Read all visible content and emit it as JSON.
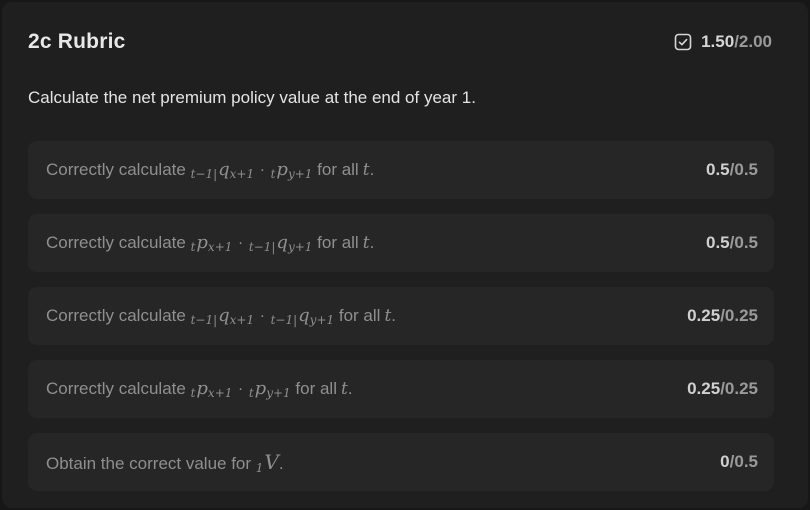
{
  "rubric": {
    "title": "2c Rubric",
    "score_earned": "1.50",
    "score_total": "/2.00",
    "question": "Calculate the net premium policy value at the end of year 1."
  },
  "items": [
    {
      "prefix": "Correctly calculate",
      "math": [
        "t−1|",
        "q",
        "x+1",
        "·",
        "t",
        "p",
        "y+1"
      ],
      "suffix_plain": "for all",
      "suffix_math": "t",
      "suffix_end": ".",
      "earned": "0.5",
      "total": "/0.5"
    },
    {
      "prefix": "Correctly calculate",
      "math": [
        "t",
        "p",
        "x+1",
        "·",
        "t−1|",
        "q",
        "y+1"
      ],
      "suffix_plain": "for all",
      "suffix_math": "t",
      "suffix_end": ".",
      "earned": "0.5",
      "total": "/0.5"
    },
    {
      "prefix": "Correctly calculate",
      "math": [
        "t−1|",
        "q",
        "x+1",
        "·",
        "t−1|",
        "q",
        "y+1"
      ],
      "suffix_plain": "for all",
      "suffix_math": "t",
      "suffix_end": ".",
      "earned": "0.25",
      "total": "/0.25"
    },
    {
      "prefix": "Correctly calculate",
      "math": [
        "t",
        "p",
        "x+1",
        "·",
        "t",
        "p",
        "y+1"
      ],
      "suffix_plain": "for all",
      "suffix_math": "t",
      "suffix_end": ".",
      "earned": "0.25",
      "total": "/0.25"
    },
    {
      "prefix": "Obtain the correct value for",
      "math_value": [
        "1",
        "V"
      ],
      "suffix_end": ".",
      "earned": "0",
      "total": "/0.5"
    }
  ],
  "icons": {
    "score_icon": "checkbox-check-icon"
  }
}
